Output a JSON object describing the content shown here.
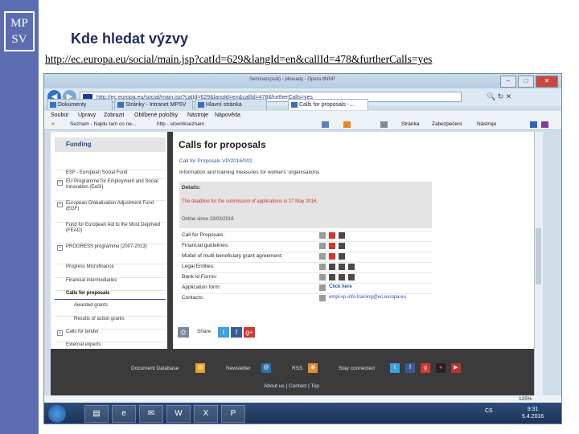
{
  "slide": {
    "logo_text": "MP SV",
    "title": "Kde hledat výzvy",
    "url": "http://ec.europa.eu/social/main.jsp?catId=629&langId=en&callId=478&furtherCalls=yes"
  },
  "browser": {
    "window_title": "Seminars(sub) - plneuaty - Opera ttNNP",
    "address": "http://ec.europa.eu/social/main.jsp?catId=629&langId=en&callId=478&furtherCalls=yes",
    "tabs": [
      "Dokumenty",
      "Stránky - Intranet MPSV",
      "Hlavní stránka",
      "Calls for proposals -..."
    ],
    "menu": [
      "Soubor",
      "Úpravy",
      "Zobrazit",
      "Oblíbené položky",
      "Nástroje",
      "Nápověda"
    ],
    "favorites": [
      "Seznam - Najdu tam co ne...",
      "http - slovnikseznam"
    ],
    "command_bar": [
      "Stránka",
      "Zabezpečení",
      "Nástroje"
    ],
    "zoom": "125%"
  },
  "funding": {
    "title": "Funding",
    "items": [
      "ESF - European Social Fund",
      "EU Programme for Employment and Social Innovation (EaSI)",
      "European Globalisation Adjustment Fund (EGF)",
      "Fund for European Aid to the Most Deprived (FEAD)",
      "PROGRESS programme (2007-2013)",
      "Progress Microfinance",
      "Financial intermediaries",
      "Calls for proposals",
      "Awarded grants",
      "Results of action grants",
      "Calls for tender",
      "External experts"
    ]
  },
  "main": {
    "title": "Calls for proposals",
    "reference": "Call for Proposals VP/2016/002",
    "subtitle": "Information and training measures for workers' organisations",
    "details_label": "Details:",
    "deadline_text": "The deadline for the submission of applications is 27 May 2016.",
    "online_since": "Online since 23/03/2016",
    "rows": [
      {
        "label": "Call for Proposals:",
        "value": ""
      },
      {
        "label": "Financial guidelines:",
        "value": ""
      },
      {
        "label": "Model of multi-beneficiary grant agreement:",
        "value": ""
      },
      {
        "label": "Legal Entities:",
        "value": ""
      },
      {
        "label": "Bank Id Forms:",
        "value": ""
      },
      {
        "label": "Application form:",
        "value": "Click here"
      },
      {
        "label": "Contacts:",
        "value": "empl-vp-info-training@ec.europa.eu"
      }
    ],
    "share_label": "Share"
  },
  "footer": {
    "links": [
      "Document Database",
      "Newsletter",
      "RSS",
      "Stay connected"
    ],
    "bottom": "About us | Contact | Top"
  },
  "taskbar": {
    "tray_lang": "CS",
    "time": "9:31",
    "date": "5.4.2016"
  },
  "colors": {
    "slide_sidebar": "#5b6cb0",
    "deadline_red": "#d22c23",
    "link_blue": "#2a57a4"
  }
}
